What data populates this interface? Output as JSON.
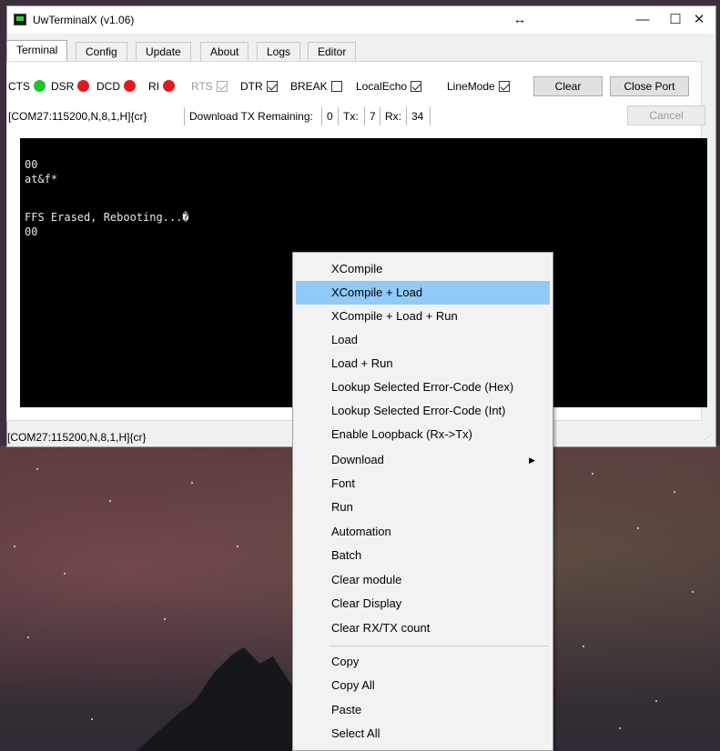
{
  "window": {
    "title": "UwTerminalX (v1.06)",
    "controls": {
      "resize": "↔",
      "minimize": "—",
      "maximize": "☐",
      "close": "✕"
    }
  },
  "tabs": [
    "Terminal",
    "Config",
    "Update",
    "About",
    "Logs",
    "Editor"
  ],
  "signals": {
    "cts": "CTS",
    "dsr": "DSR",
    "dcd": "DCD",
    "ri": "RI",
    "rts": "RTS",
    "dtr": "DTR",
    "brk": "BREAK",
    "localecho": "LocalEcho",
    "linemode": "LineMode"
  },
  "buttons": {
    "clear": "Clear",
    "close_port": "Close Port",
    "cancel": "Cancel"
  },
  "info": {
    "port": "[COM27:115200,N,8,1,H]{cr}",
    "download_label": "Download TX Remaining:",
    "download_value": "0",
    "tx_label": "Tx:",
    "tx_value": "7",
    "rx_label": "Rx:",
    "rx_value": "34"
  },
  "terminal": {
    "lines": [
      "00",
      "at&f*",
      "",
      "FFS Erased, Rebooting...�",
      "00"
    ]
  },
  "status": {
    "text": "[COM27:115200,N,8,1,H]{cr}"
  },
  "menu": {
    "items": [
      "XCompile",
      "XCompile + Load",
      "XCompile + Load + Run",
      "Load",
      "Load + Run",
      "Lookup Selected Error-Code (Hex)",
      "Lookup Selected Error-Code (Int)",
      "Enable Loopback (Rx->Tx)",
      "Download",
      "Font",
      "Run",
      "Automation",
      "Batch",
      "Clear module",
      "Clear Display",
      "Clear RX/TX count",
      "Copy",
      "Copy All",
      "Paste",
      "Select All"
    ],
    "submenu_arrow": "▶"
  }
}
